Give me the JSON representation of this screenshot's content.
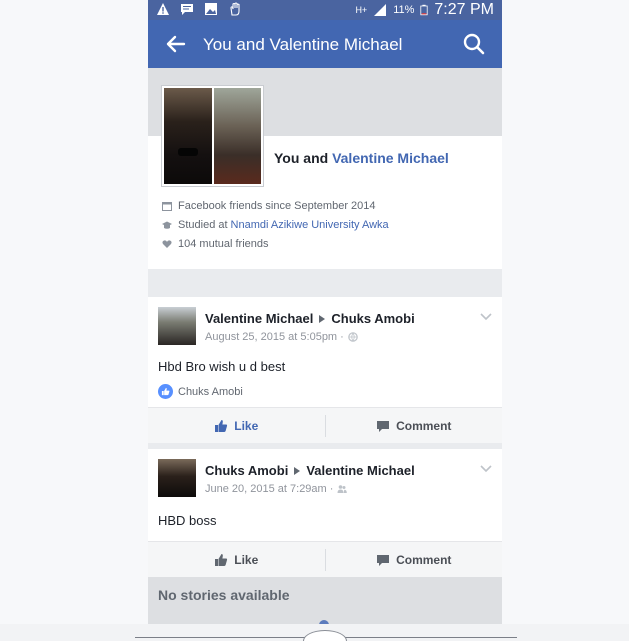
{
  "status_bar": {
    "network": "H+",
    "battery_percent": "11%",
    "time": "7:27 PM",
    "icons": [
      "warning-icon",
      "message-icon",
      "image-icon",
      "hand-icon",
      "signal-icon",
      "battery-icon"
    ]
  },
  "app_bar": {
    "title": "You and Valentine Michael",
    "back_icon": "arrow-left-icon",
    "search_icon": "search-icon",
    "color": "#4267b2"
  },
  "friendship": {
    "names_prefix": "You and",
    "friend_name": "Valentine Michael",
    "facts": {
      "friends_since": "Facebook friends since September 2014",
      "studied_prefix": "Studied at",
      "school": "Nnamdi Azikiwe University Awka",
      "mutual": "104 mutual friends"
    }
  },
  "posts": [
    {
      "author": "Valentine Michael",
      "target": "Chuks Amobi",
      "meta": "August 25, 2015 at 5:05pm ·",
      "privacy_icon": "globe-icon",
      "text": "Hbd Bro wish u d best",
      "likers": "Chuks Amobi",
      "actions": {
        "like": "Like",
        "comment": "Comment"
      }
    },
    {
      "author": "Chuks Amobi",
      "target": "Valentine Michael",
      "meta": "June 20, 2015 at 7:29am ·",
      "privacy_icon": "friends-icon",
      "text": "HBD boss",
      "actions": {
        "like": "Like",
        "comment": "Comment"
      }
    }
  ],
  "footer": {
    "no_stories": "No stories available"
  }
}
